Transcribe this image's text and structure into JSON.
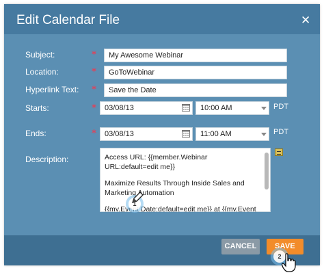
{
  "dialog": {
    "title": "Edit Calendar File",
    "close_icon": "close-x-icon"
  },
  "form": {
    "subject": {
      "label": "Subject:",
      "value": "My Awesome Webinar"
    },
    "location": {
      "label": "Location:",
      "value": "GoToWebinar"
    },
    "hyperlink": {
      "label": "Hyperlink Text:",
      "value": "Save the Date"
    },
    "starts": {
      "label": "Starts:",
      "date": "03/08/13",
      "time": "10:00 AM",
      "timezone": "PDT"
    },
    "ends": {
      "label": "Ends:",
      "date": "03/08/13",
      "time": "11:00 AM",
      "timezone": "PDT"
    },
    "description": {
      "label": "Description:",
      "line1": "Access URL: {{member.Webinar URL:default=edit me}}",
      "line2": "Maximize Results Through Inside Sales and Marketing Automation",
      "line3": "{{my.Event Date:default=edit me}} at {{my.Event Time}}"
    },
    "required_marker": "*"
  },
  "footer": {
    "cancel_label": "CANCEL",
    "save_label": "SAVE"
  },
  "callouts": {
    "step1": "1",
    "step2": "2"
  },
  "colors": {
    "dialog_bg": "#5b8fb3",
    "header_bg": "#467aa0",
    "footer_bg": "#3e6f92",
    "required": "#e0425a",
    "save_button": "#f28c2a",
    "cancel_button": "#8a9aa6"
  }
}
